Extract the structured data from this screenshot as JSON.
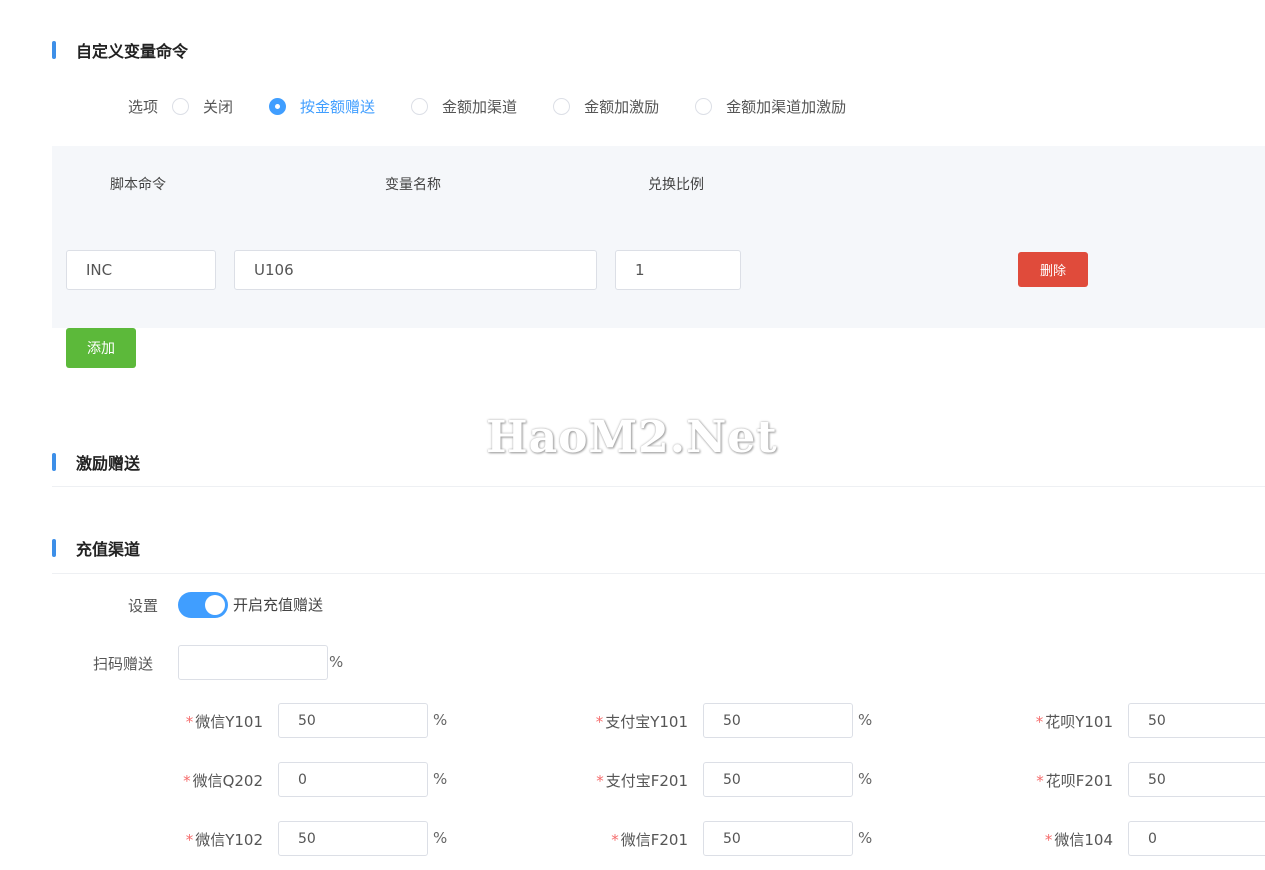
{
  "sections": {
    "custom_cmd": "自定义变量命令",
    "incentive": "激励赠送",
    "recharge": "充值渠道"
  },
  "options": {
    "label": "选项",
    "items": [
      {
        "label": "关闭",
        "checked": false
      },
      {
        "label": "按金额赠送",
        "checked": true
      },
      {
        "label": "金额加渠道",
        "checked": false
      },
      {
        "label": "金额加激励",
        "checked": false
      },
      {
        "label": "金额加渠道加激励",
        "checked": false
      }
    ]
  },
  "cmd_table": {
    "headers": [
      "脚本命令",
      "变量名称",
      "兑换比例"
    ],
    "row": {
      "command": "INC",
      "variable": "U106",
      "ratio": "1"
    },
    "delete_label": "删除",
    "add_label": "添加"
  },
  "watermark": "HaoM2.Net",
  "recharge": {
    "setting_label": "设置",
    "switch_label": "开启充值赠送",
    "switch_on": true,
    "scan_label": "扫码赠送",
    "scan_value": "",
    "percent": "%",
    "required_mark": "*",
    "channels": [
      {
        "label": "微信Y101",
        "value": "50"
      },
      {
        "label": "支付宝Y101",
        "value": "50"
      },
      {
        "label": "花呗Y101",
        "value": "50"
      },
      {
        "label": "微信Q202",
        "value": "0"
      },
      {
        "label": "支付宝F201",
        "value": "50"
      },
      {
        "label": "花呗F201",
        "value": "50"
      },
      {
        "label": "微信Y102",
        "value": "50"
      },
      {
        "label": "微信F201",
        "value": "50"
      },
      {
        "label": "微信104",
        "value": "0"
      }
    ]
  },
  "colors": {
    "accent": "#409eff",
    "danger": "#e04b3b",
    "success": "#5cb93a"
  }
}
